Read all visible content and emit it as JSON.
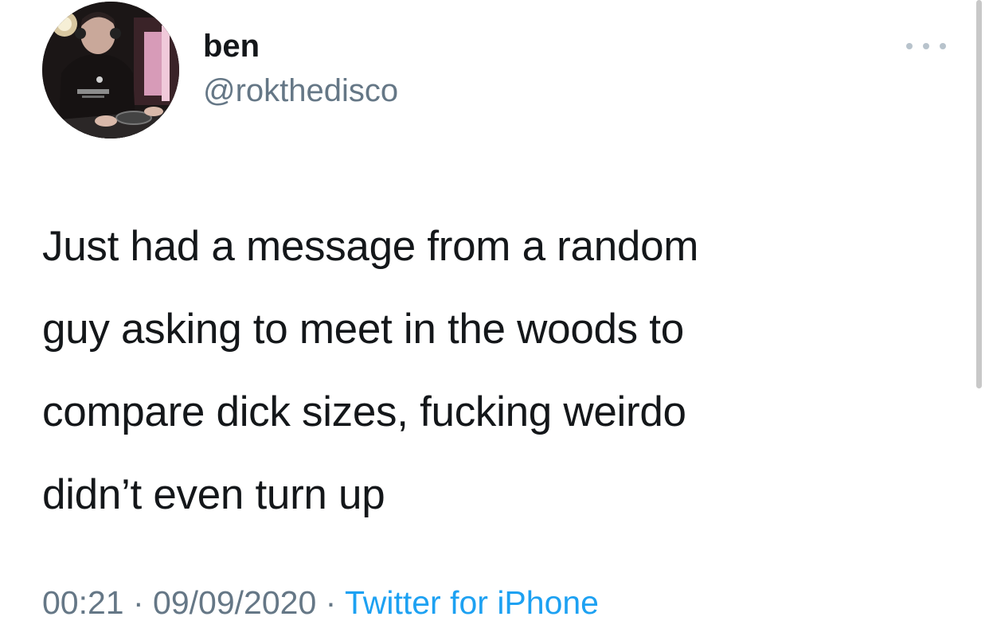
{
  "tweet": {
    "display_name": "ben",
    "handle": "@rokthedisco",
    "text": "Just had a message from a random\nguy asking to meet in the woods to\ncompare dick sizes, fucking weirdo\ndidn’t even turn up",
    "time": "00:21",
    "date": "09/09/2020",
    "separator": " · ",
    "source": "Twitter for iPhone",
    "more_icon": "more-horizontal-icon",
    "avatar_icon": "profile-photo"
  },
  "colors": {
    "text": "#14171a",
    "secondary": "#657786",
    "link": "#1da1f2",
    "background": "#ffffff"
  }
}
